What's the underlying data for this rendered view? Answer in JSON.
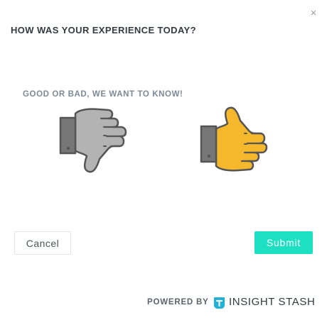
{
  "dialog": {
    "close_glyph": "×",
    "title": "HOW WAS YOUR EXPERIENCE TODAY?",
    "subtitle": "GOOD OR BAD, WE WANT TO KNOW!"
  },
  "feedback": {
    "thumbs_down": {
      "icon": "thumbs-down-icon",
      "color": "#b3b3b3"
    },
    "thumbs_up": {
      "icon": "thumbs-up-icon",
      "color": "#f5b72c"
    }
  },
  "actions": {
    "cancel_label": "Cancel",
    "submit_label": "Submit"
  },
  "footer": {
    "powered_by": "POWERED BY",
    "brand_name": "INSIGHT STASH",
    "brand_logo_icon": "insight-stash-logo-icon"
  },
  "colors": {
    "accent": "#1de0c3",
    "title_text": "#333a40",
    "subtitle_text": "#7d8a95",
    "sleeve": "#777777",
    "outline": "#555555"
  }
}
